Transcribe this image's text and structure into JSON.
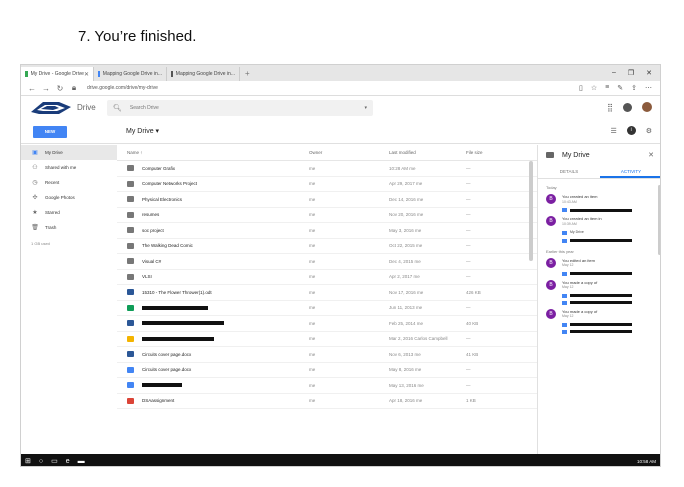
{
  "caption": "7. You’re finished.",
  "browser": {
    "tabs": [
      {
        "label": "My Drive - Google Drive",
        "color": "#34a853",
        "active": true
      },
      {
        "label": "Mapping Google Drive in...",
        "color": "#4285f4",
        "active": false
      },
      {
        "label": "Mapping Google Drive in...",
        "color": "#555555",
        "active": false
      }
    ],
    "new_tab": "+",
    "window_controls": [
      "–",
      "❐",
      "✕"
    ],
    "url": "drive.google.com/drive/my-drive",
    "nav": {
      "back": "←",
      "forward": "→",
      "refresh": "↻"
    }
  },
  "drive": {
    "title": "Drive",
    "search_placeholder": "Search Drive",
    "new_button": "NEW",
    "current_folder": "My Drive ▾",
    "sidebar": [
      {
        "label": "My Drive",
        "icon": "my-drive-icon",
        "glyph": "▣",
        "active": true
      },
      {
        "label": "Shared with me",
        "icon": "people-icon",
        "glyph": "👥",
        "active": false
      },
      {
        "label": "Recent",
        "icon": "clock-icon",
        "glyph": "◷",
        "active": false
      },
      {
        "label": "Google Photos",
        "icon": "pinwheel-icon",
        "glyph": "✣",
        "active": false
      },
      {
        "label": "Starred",
        "icon": "star-icon",
        "glyph": "★",
        "active": false
      },
      {
        "label": "Trash",
        "icon": "trash-icon",
        "glyph": "🗑",
        "active": false
      }
    ],
    "storage": "1 GB used",
    "columns": {
      "name": "Name ↑",
      "owner": "Owner",
      "modified": "Last modified",
      "size": "File size"
    },
    "files": [
      {
        "name": "Computer Grafix",
        "owner": "me",
        "modified": "10:28 AM me",
        "size": "—",
        "type": "folder",
        "redacted": false
      },
      {
        "name": "Computer Networks Project",
        "owner": "me",
        "modified": "Apr 29, 2017 me",
        "size": "—",
        "type": "shared-folder",
        "redacted": false
      },
      {
        "name": "Physical Electronics",
        "owner": "me",
        "modified": "Dec 14, 2016 me",
        "size": "—",
        "type": "shared-folder",
        "redacted": false
      },
      {
        "name": "resumes",
        "owner": "me",
        "modified": "Nov 20, 2016 me",
        "size": "—",
        "type": "folder",
        "redacted": false
      },
      {
        "name": "soc project",
        "owner": "me",
        "modified": "May 3, 2016 me",
        "size": "—",
        "type": "folder",
        "redacted": false
      },
      {
        "name": "The Walking Dead Comic",
        "owner": "me",
        "modified": "Oct 22, 2015 me",
        "size": "—",
        "type": "folder",
        "redacted": false
      },
      {
        "name": "Visual C#",
        "owner": "me",
        "modified": "Dec 4, 2015 me",
        "size": "—",
        "type": "folder",
        "redacted": false
      },
      {
        "name": "VLSI",
        "owner": "me",
        "modified": "Apr 2, 2017 me",
        "size": "—",
        "type": "shared-folder",
        "redacted": false
      },
      {
        "name": "15310 - The Flower Thrower(1).odt",
        "owner": "me",
        "modified": "Nov 17, 2016 me",
        "size": "426 KB",
        "type": "word",
        "redacted": false
      },
      {
        "name": "",
        "owner": "me",
        "modified": "Jun 11, 2013 me",
        "size": "—",
        "type": "sheet",
        "redacted": true
      },
      {
        "name": "",
        "owner": "me",
        "modified": "Feb 25, 2014 me",
        "size": "40 KB",
        "type": "word",
        "redacted": true
      },
      {
        "name": "",
        "owner": "me",
        "modified": "Mar 2, 2016 Carlos Campbell",
        "size": "—",
        "type": "slides",
        "redacted": true
      },
      {
        "name": "Circuits cover page.docx",
        "owner": "me",
        "modified": "Nov 6, 2013 me",
        "size": "41 KB",
        "type": "word",
        "redacted": false
      },
      {
        "name": "Circuits cover page.docx",
        "owner": "me",
        "modified": "May 8, 2016 me",
        "size": "—",
        "type": "doc",
        "redacted": false
      },
      {
        "name": "",
        "owner": "me",
        "modified": "May 13, 2016 me",
        "size": "—",
        "type": "doc",
        "redacted": true
      },
      {
        "name": "DSAassignment",
        "owner": "me",
        "modified": "Apr 18, 2016 me",
        "size": "1 KB",
        "type": "pdf",
        "redacted": false
      }
    ],
    "details": {
      "title": "My Drive",
      "close": "✕",
      "tabs": [
        "DETAILS",
        "ACTIVITY"
      ],
      "today_label": "Today",
      "earlier_label": "Earlier this year",
      "activities": [
        {
          "avatar": "B",
          "text": "You created an item",
          "time": "10:43 AM",
          "files": [
            ""
          ]
        },
        {
          "avatar": "B",
          "text": "You created an item in",
          "time": "10:39 AM",
          "files": [
            "My Drive",
            ""
          ]
        },
        {
          "avatar": "B",
          "text": "You edited an item",
          "time": "May 12",
          "files": [
            ""
          ]
        },
        {
          "avatar": "B",
          "text": "You made a copy of",
          "time": "May 12",
          "files": [
            "",
            ""
          ]
        },
        {
          "avatar": "B",
          "text": "You made a copy of",
          "time": "May 12",
          "files": [
            "",
            ""
          ]
        }
      ]
    }
  },
  "taskbar": {
    "clock": "10:58 AM"
  },
  "colors": {
    "accent": "#4285f4",
    "avatar": "#7b1fa2",
    "taskbar": "#111111"
  }
}
